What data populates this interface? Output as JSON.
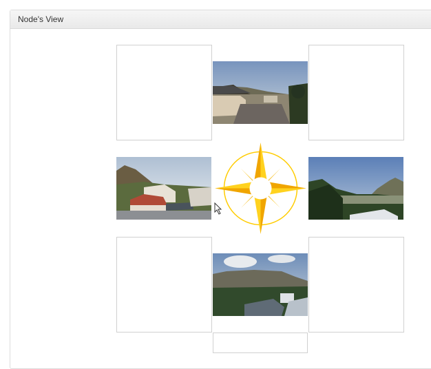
{
  "panel": {
    "title": "Node's View"
  },
  "grid": {
    "north": {
      "kind": "photo",
      "icon": "photo-rooftop-mountain"
    },
    "west": {
      "kind": "photo",
      "icon": "photo-red-roof-houses"
    },
    "east": {
      "kind": "photo",
      "icon": "photo-city-bay-hills"
    },
    "south": {
      "kind": "photo",
      "icon": "photo-table-mountain"
    },
    "center": {
      "kind": "compass",
      "icon": "compass-rose-icon"
    }
  },
  "colors": {
    "compass_dark": "#f0a500",
    "compass_light": "#ffd21f",
    "panel_border": "#dcdcdc",
    "cell_border": "#d0d0d0"
  }
}
